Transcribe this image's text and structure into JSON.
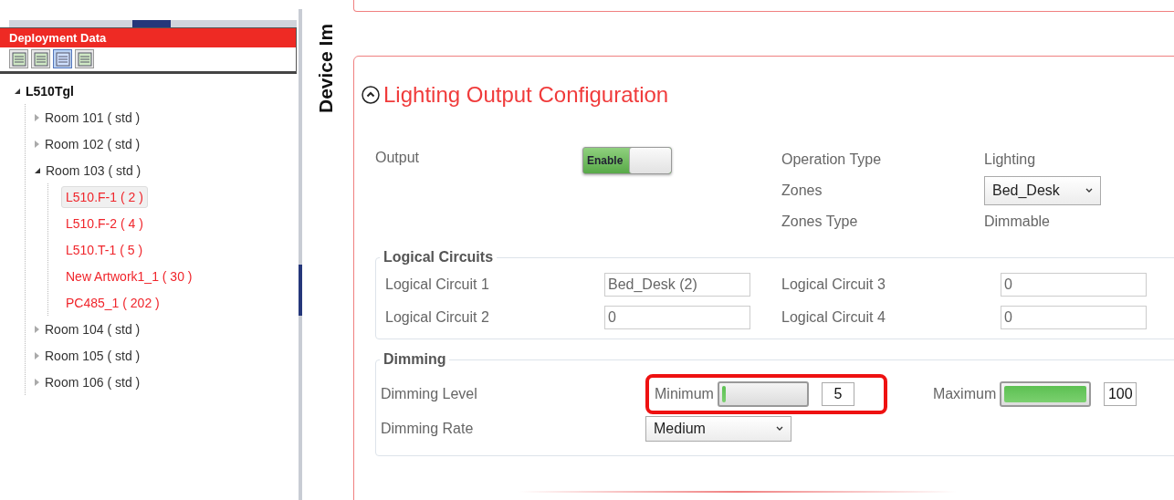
{
  "sidebar": {
    "title": "Deployment Data",
    "toolbar": [
      {
        "selected": false
      },
      {
        "selected": false
      },
      {
        "selected": true
      },
      {
        "selected": false
      }
    ],
    "tree": [
      {
        "label": "L510Tgl",
        "expanded": true,
        "children": [
          {
            "label": "Room 101 ( std )",
            "expanded": false
          },
          {
            "label": "Room 102 ( std )",
            "expanded": false
          },
          {
            "label": "Room 103 ( std )",
            "expanded": true,
            "children": [
              {
                "label": "L510.F-1  ( 2 )",
                "selected": true
              },
              {
                "label": "L510.F-2  ( 4 )",
                "selected": false
              },
              {
                "label": "L510.T-1  ( 5 )",
                "selected": false
              },
              {
                "label": "New Artwork1_1  ( 30 )",
                "selected": false
              },
              {
                "label": "PC485_1  ( 202 )",
                "selected": false
              }
            ]
          },
          {
            "label": "Room 104 ( std )",
            "expanded": false
          },
          {
            "label": "Room 105 ( std )",
            "expanded": false
          },
          {
            "label": "Room 106 ( std )",
            "expanded": false
          }
        ]
      }
    ]
  },
  "side_tab": {
    "label": "Device Im"
  },
  "section": {
    "title": "Lighting Output Configuration",
    "expanded": true,
    "output": {
      "label": "Output",
      "toggle_label": "Enable",
      "on": true
    },
    "info": [
      {
        "label": "Operation Type",
        "kind": "text",
        "value": "Lighting"
      },
      {
        "label": "Zones",
        "kind": "select",
        "value": "Bed_Desk"
      },
      {
        "label": "Zones Type",
        "kind": "text",
        "value": "Dimmable"
      }
    ],
    "logical_circuits": {
      "title": "Logical Circuits",
      "fields": [
        {
          "label": "Logical Circuit 1",
          "value": "Bed_Desk (2)"
        },
        {
          "label": "Logical Circuit 3",
          "value": "0"
        },
        {
          "label": "Logical Circuit 2",
          "value": "0"
        },
        {
          "label": "Logical Circuit 4",
          "value": "0"
        }
      ]
    },
    "dimming": {
      "title": "Dimming",
      "level_label": "Dimming Level",
      "sliders": [
        {
          "label": "Minimum",
          "level": 0.05,
          "value": "5",
          "highlighted": true
        },
        {
          "label": "Maximum",
          "level": 1,
          "value": "100",
          "highlighted": false
        }
      ],
      "rate_label": "Dimming Rate",
      "rate": "Medium"
    }
  }
}
